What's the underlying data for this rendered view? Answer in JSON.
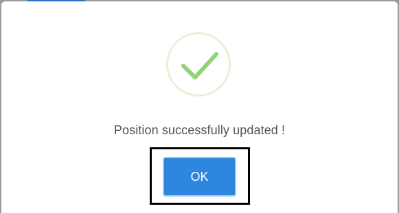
{
  "dialog": {
    "message": "Position successfully updated !",
    "ok_label": "OK",
    "icon": "checkmark-icon",
    "colors": {
      "check": "#8fd376",
      "ring": "#e3f3d8",
      "button": "#2e86de",
      "message_text": "#545454",
      "backdrop": "#9a9a9a"
    }
  }
}
